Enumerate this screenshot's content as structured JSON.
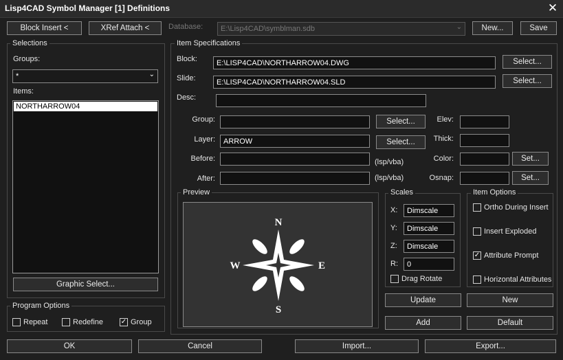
{
  "window": {
    "title": "Lisp4CAD Symbol Manager [1] Definitions",
    "close_icon": "close-icon"
  },
  "toolbar": {
    "block_insert": "Block Insert <",
    "xref_attach": "XRef Attach <",
    "database_label": "Database:",
    "database_value": "E:\\Lisp4CAD\\symblman.sdb",
    "new": "New...",
    "save": "Save"
  },
  "selections": {
    "title": "Selections",
    "groups_label": "Groups:",
    "groups_value": "*",
    "items_label": "Items:",
    "items": [
      "NORTHARROW04"
    ],
    "graphic_select": "Graphic Select..."
  },
  "program_options": {
    "title": "Program Options",
    "repeat": {
      "label": "Repeat",
      "checked": false
    },
    "redefine": {
      "label": "Redefine",
      "checked": false
    },
    "group": {
      "label": "Group",
      "checked": true
    }
  },
  "item_spec": {
    "title": "Item Specifications",
    "block_label": "Block:",
    "block_value": "E:\\LISP4CAD\\NORTHARROW04.DWG",
    "slide_label": "Slide:",
    "slide_value": "E:\\LISP4CAD\\NORTHARROW04.SLD",
    "desc_label": "Desc:",
    "desc_value": "",
    "select": "Select...",
    "group_label": "Group:",
    "group_value": "",
    "layer_label": "Layer:",
    "layer_value": "ARROW",
    "before_label": "Before:",
    "before_value": "",
    "after_label": "After:",
    "after_value": "",
    "lsp_vba": "(lsp/vba)",
    "elev_label": "Elev:",
    "elev_value": "",
    "thick_label": "Thick:",
    "thick_value": "",
    "color_label": "Color:",
    "color_value": "",
    "osnap_label": "Osnap:",
    "osnap_value": "",
    "set": "Set..."
  },
  "preview": {
    "title": "Preview",
    "compass": {
      "n": "N",
      "s": "S",
      "e": "E",
      "w": "W"
    }
  },
  "scales": {
    "title": "Scales",
    "x_label": "X:",
    "x_value": "Dimscale",
    "y_label": "Y:",
    "y_value": "Dimscale",
    "z_label": "Z:",
    "z_value": "Dimscale",
    "r_label": "R:",
    "r_value": "0",
    "drag_rotate": {
      "label": "Drag Rotate",
      "checked": false
    }
  },
  "item_options": {
    "title": "Item Options",
    "ortho": {
      "label": "Ortho During Insert",
      "checked": false
    },
    "exploded": {
      "label": "Insert Exploded",
      "checked": false
    },
    "attr_prompt": {
      "label": "Attribute Prompt",
      "checked": true
    },
    "horiz_attr": {
      "label": "Horizontal Attributes",
      "checked": false
    }
  },
  "actions": {
    "update": "Update",
    "new": "New",
    "add": "Add",
    "default": "Default"
  },
  "footer": {
    "ok": "OK",
    "cancel": "Cancel",
    "import": "Import...",
    "export": "Export..."
  }
}
